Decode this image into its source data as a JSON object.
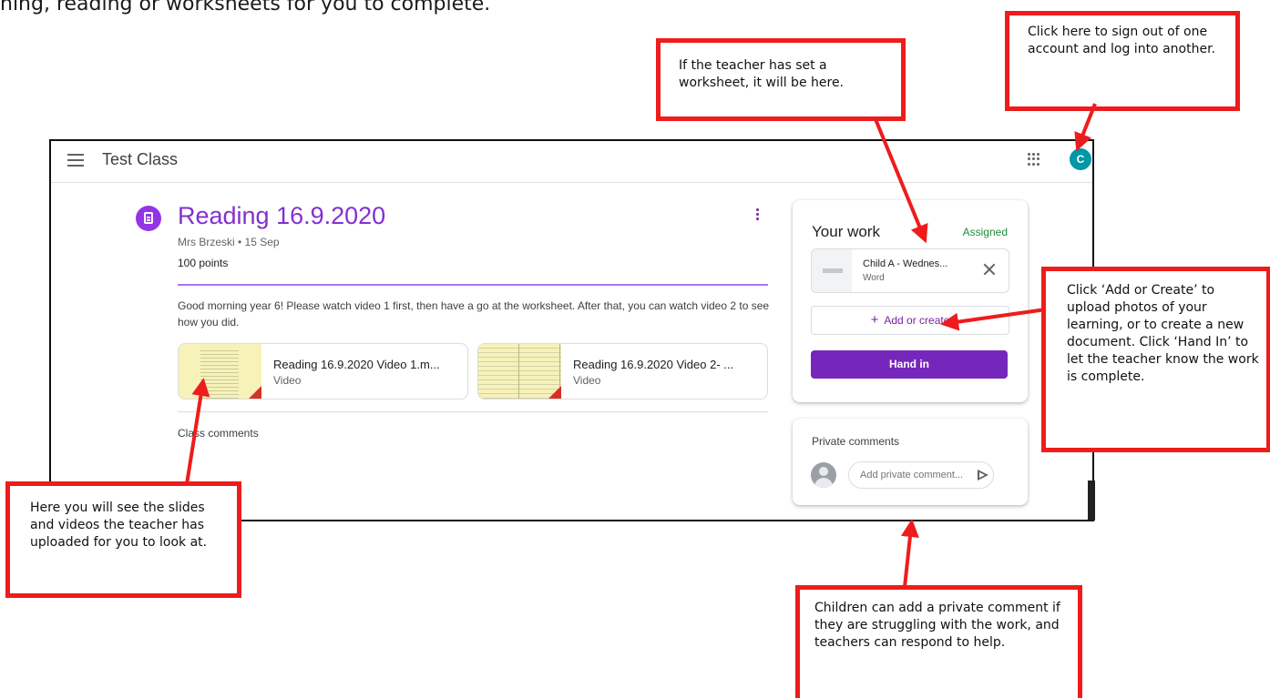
{
  "document": {
    "intro_line": "ning, reading or worksheets for you to complete."
  },
  "app": {
    "class_name": "Test Class",
    "account_initial": "C",
    "avatar_color": "#0097a7"
  },
  "assignment": {
    "title": "Reading 16.9.2020",
    "meta": "Mrs Brzeski • 15 Sep",
    "points": "100 points",
    "description": "Good morning year 6! Please watch video 1 first, then have a go at the worksheet. After that, you can watch video 2 to see how you did.",
    "attachments": [
      {
        "name": "Reading 16.9.2020 Video 1.m...",
        "type": "Video"
      },
      {
        "name": "Reading 16.9.2020 Video 2- ...",
        "type": "Video"
      }
    ],
    "class_comments_label": "Class comments",
    "accent_color": "#8430ce"
  },
  "your_work": {
    "title": "Your work",
    "status": "Assigned",
    "status_color": "#1e8e3e",
    "file": {
      "name": "Child A - Wednes...",
      "type": "Word"
    },
    "add_label": "Add or create",
    "hand_in_label": "Hand in"
  },
  "private_comments": {
    "title": "Private comments",
    "placeholder": "Add private comment..."
  },
  "callouts": {
    "sign_out": "Click here to sign out of one account and log into another.",
    "worksheet": "If the teacher has set a worksheet, it will be here.",
    "add_create": "Click ‘Add or Create’ to upload photos of your learning, or to create a new document. Click ‘Hand In’ to let the teacher know the work is complete.",
    "slides_videos": "Here you will see the slides and videos the teacher has uploaded for you to look at.",
    "private_comment": "Children can add a private comment if they are struggling with the work, and teachers can respond to help.",
    "border_color": "#ee1c1c"
  },
  "icons": [
    "menu-icon",
    "assignment-icon",
    "more-vert-icon",
    "apps-icon",
    "close-icon",
    "add-icon",
    "person-icon",
    "send-icon"
  ]
}
